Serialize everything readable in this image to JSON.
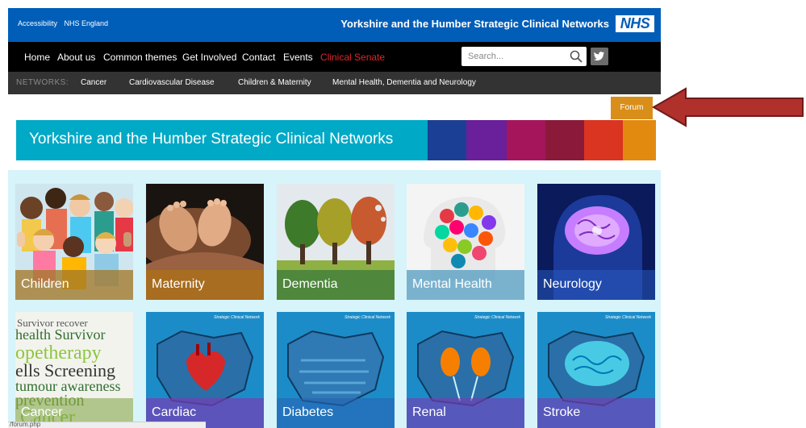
{
  "header": {
    "utility_links": [
      "Accessibility",
      "NHS England"
    ],
    "site_name": "Yorkshire and the Humber Strategic Clinical Networks",
    "logo_text": "NHS",
    "brand_color": "#005eb8"
  },
  "main_nav": {
    "items": [
      "Home",
      "About us",
      "Common themes",
      "Get Involved",
      "Contact",
      "Events",
      "Clinical Senate"
    ],
    "accent_item_color": "#e0242b",
    "search": {
      "placeholder": "Search...",
      "icon": "search-icon"
    },
    "social_icon": "twitter-icon"
  },
  "networks_nav": {
    "label": "NETWORKS:",
    "items": [
      "Cancer",
      "Cardiovascular Disease",
      "Children & Maternity",
      "Mental Health, Dementia and Neurology"
    ]
  },
  "forum_button": {
    "label": "Forum",
    "color": "#d98e1a"
  },
  "banner": {
    "title": "Yorkshire and the Humber Strategic Clinical Networks",
    "color": "#00a9c6",
    "stripe_colors": [
      "#1b3f95",
      "#6a1f9b",
      "#a4155c",
      "#8b1a3a",
      "#d93521",
      "#e28a10"
    ]
  },
  "tiles": [
    {
      "label": "Children",
      "icon": "children-photo"
    },
    {
      "label": "Maternity",
      "icon": "baby-feet-photo"
    },
    {
      "label": "Dementia",
      "icon": "dementia-trees-photo"
    },
    {
      "label": "Mental Health",
      "icon": "puzzle-head-photo"
    },
    {
      "label": "Neurology",
      "icon": "brain-photo"
    },
    {
      "label": "Cancer",
      "icon": "word-cloud-image"
    },
    {
      "label": "Cardiac",
      "icon": "heart-map-image",
      "badge": "Strategic Clinical Network"
    },
    {
      "label": "Diabetes",
      "icon": "diabetes-map-image",
      "badge": "Strategic Clinical Network"
    },
    {
      "label": "Renal",
      "icon": "kidney-map-image",
      "badge": "Strategic Clinical Network"
    },
    {
      "label": "Stroke",
      "icon": "brain-map-image",
      "badge": "Strategic Clinical Network"
    }
  ],
  "status_bar": {
    "text": "/forum.php"
  },
  "annotation": {
    "arrow_color": "#b0302c",
    "arrow_icon": "pointer-arrow-icon"
  }
}
